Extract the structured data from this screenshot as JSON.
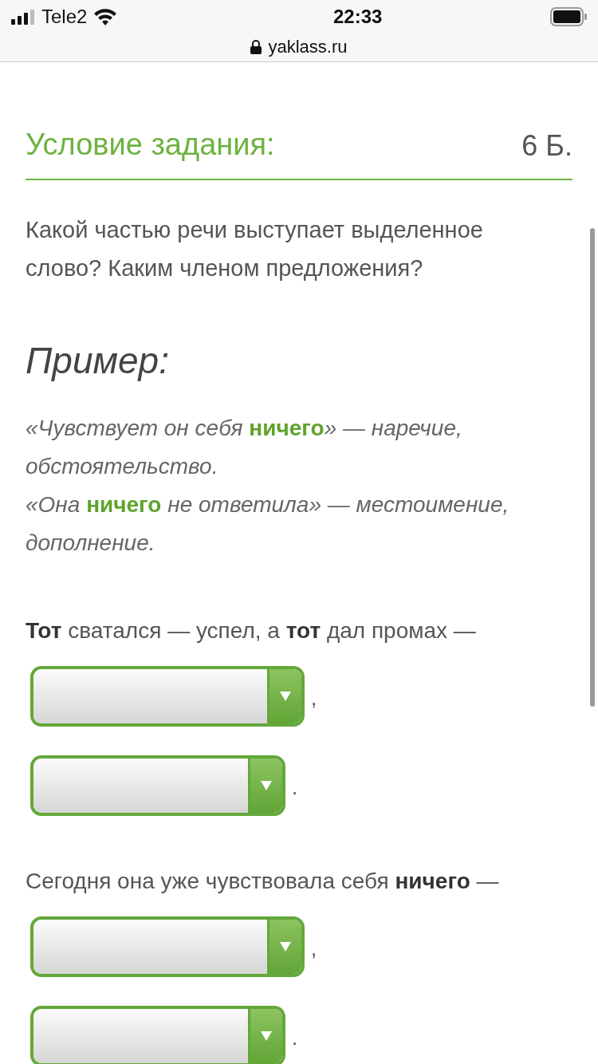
{
  "status_bar": {
    "carrier": "Tele2",
    "time": "22:33",
    "url": "yaklass.ru"
  },
  "task": {
    "title": "Условие задания:",
    "points": "6 Б.",
    "question": "Какой частью речи выступает выделенное слово? Каким членом предложения?"
  },
  "example": {
    "title": "Пример:",
    "lines": [
      "«Чувствует он себя **ничего**» — наречие, обстоятельство.",
      "«Она **ничего** не ответила» — местоимение, дополнение."
    ]
  },
  "exercises": [
    {
      "sentence": "**Тот** сватался — успел, а **тот** дал промах —",
      "selects": [
        {
          "after": ","
        },
        {
          "after": "."
        }
      ]
    },
    {
      "sentence": "Сегодня она уже чувствовала себя **ничего** —",
      "selects": [
        {
          "after": ","
        },
        {
          "after": "."
        }
      ]
    }
  ]
}
